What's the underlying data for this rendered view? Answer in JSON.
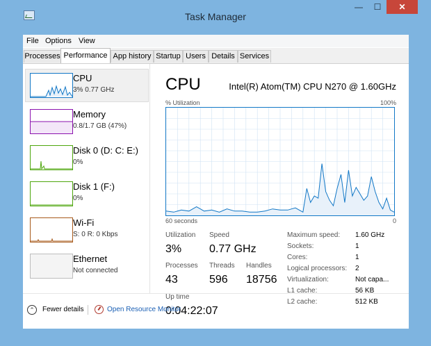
{
  "window": {
    "title": "Task Manager",
    "controls": {
      "minimize": "—",
      "maximize": "☐",
      "close": "✕"
    }
  },
  "menu": [
    "File",
    "Options",
    "View"
  ],
  "tabs": [
    "Processes",
    "Performance",
    "App history",
    "Startup",
    "Users",
    "Details",
    "Services"
  ],
  "active_tab": "Performance",
  "sidebar": {
    "items": [
      {
        "name": "CPU",
        "sub": "3% 0.77 GHz",
        "color": "#1177c6",
        "selected": true
      },
      {
        "name": "Memory",
        "sub": "0.8/1.7 GB (47%)",
        "color": "#8b12ae",
        "selected": false
      },
      {
        "name": "Disk 0 (D: C: E:)",
        "sub": "0%",
        "color": "#4da60c",
        "selected": false
      },
      {
        "name": "Disk 1 (F:)",
        "sub": "0%",
        "color": "#4da60c",
        "selected": false
      },
      {
        "name": "Wi-Fi",
        "sub": "S: 0 R: 0 Kbps",
        "color": "#a7591a",
        "selected": false
      },
      {
        "name": "Ethernet",
        "sub": "Not connected",
        "color": "#999999",
        "selected": false
      }
    ]
  },
  "main": {
    "title": "CPU",
    "model": "Intel(R) Atom(TM) CPU N270 @ 1.60GHz",
    "graph_label_top_left": "% Utilization",
    "graph_label_top_right": "100%",
    "graph_label_bottom_left": "60 seconds",
    "graph_label_bottom_right": "0",
    "stats": {
      "utilization": {
        "label": "Utilization",
        "value": "3%"
      },
      "speed": {
        "label": "Speed",
        "value": "0.77 GHz"
      },
      "processes": {
        "label": "Processes",
        "value": "43"
      },
      "threads": {
        "label": "Threads",
        "value": "596"
      },
      "handles": {
        "label": "Handles",
        "value": "18756"
      },
      "uptime": {
        "label": "Up time",
        "value": "0:04:22:07"
      }
    },
    "specs": [
      {
        "label": "Maximum speed:",
        "value": "1.60 GHz"
      },
      {
        "label": "Sockets:",
        "value": "1"
      },
      {
        "label": "Cores:",
        "value": "1"
      },
      {
        "label": "Logical processors:",
        "value": "2"
      },
      {
        "label": "Virtualization:",
        "value": "Not capa..."
      },
      {
        "label": "L1 cache:",
        "value": "56 KB"
      },
      {
        "label": "L2 cache:",
        "value": "512 KB"
      }
    ]
  },
  "footer": {
    "fewer_details": "Fewer details",
    "open_resource_monitor": "Open Resource Monitor"
  },
  "chart_data": {
    "type": "area",
    "ylim": [
      0,
      100
    ],
    "xlim": [
      60,
      0
    ],
    "x": [
      60,
      58,
      56,
      54,
      52,
      50,
      48,
      46,
      44,
      42,
      40,
      38,
      36,
      34,
      32,
      30,
      28,
      26,
      24,
      23,
      22,
      21,
      20,
      19,
      18,
      17,
      16,
      15,
      14,
      13,
      12,
      11,
      10,
      9,
      8,
      7,
      6,
      5,
      4,
      3,
      2,
      1,
      0
    ],
    "values": [
      4,
      3,
      5,
      4,
      8,
      4,
      5,
      3,
      6,
      4,
      4,
      3,
      3,
      4,
      6,
      5,
      5,
      7,
      3,
      25,
      12,
      18,
      16,
      48,
      22,
      14,
      9,
      25,
      38,
      12,
      42,
      18,
      26,
      20,
      14,
      18,
      36,
      22,
      12,
      6,
      16,
      5,
      3
    ],
    "colors": {
      "stroke": "#1177c6",
      "fill": "#e8f1fa",
      "grid": "#cfe2f3"
    }
  }
}
